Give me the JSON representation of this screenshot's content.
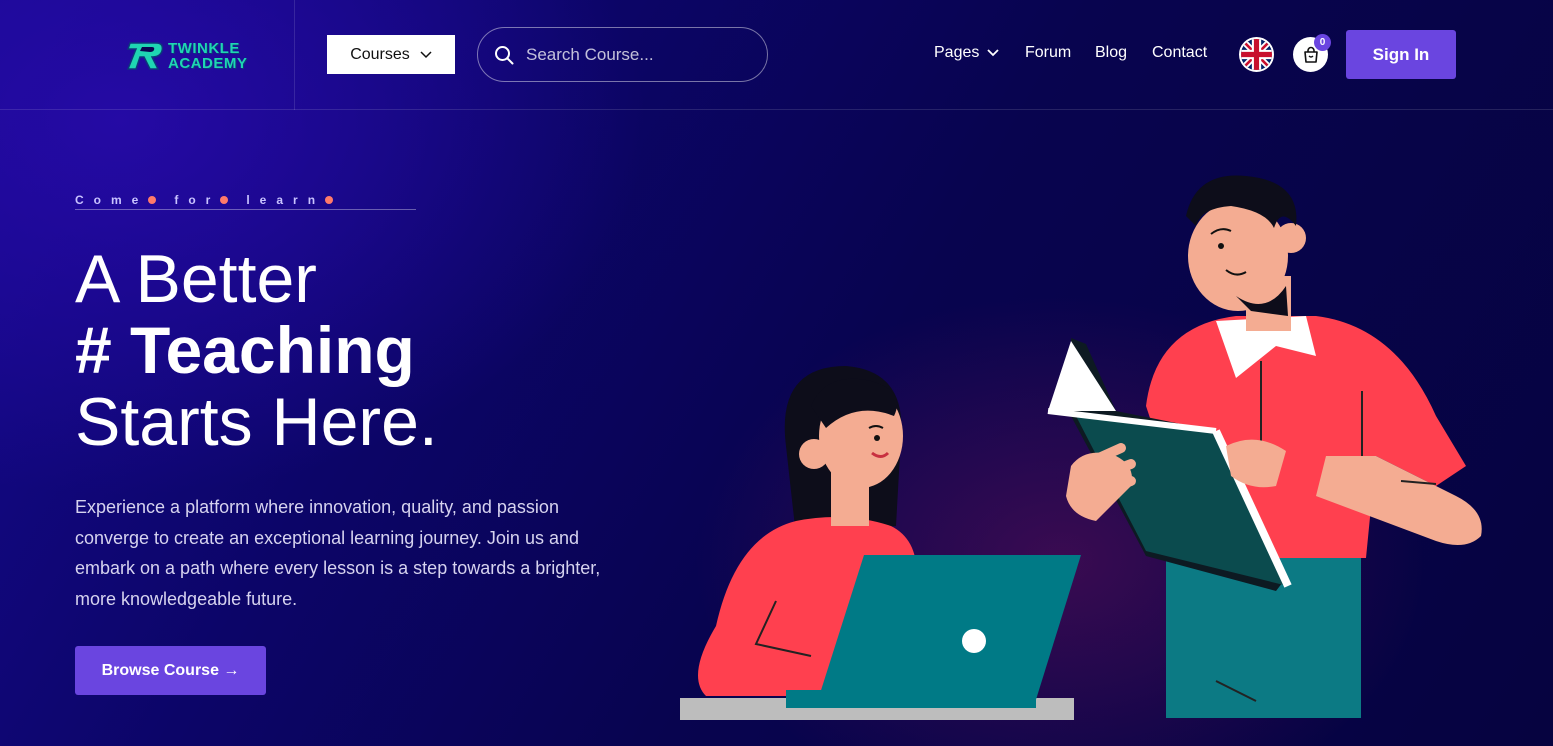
{
  "brand": {
    "name_line1": "TWINKLE",
    "name_line2": "ACADEMY",
    "accent_color": "#6a45e0",
    "logo_color": "#1fd6b2"
  },
  "header": {
    "courses_label": "Courses",
    "search_placeholder": "Search Course...",
    "nav": [
      {
        "label": "Pages",
        "has_dropdown": true
      },
      {
        "label": "Forum",
        "has_dropdown": false
      },
      {
        "label": "Blog",
        "has_dropdown": false
      },
      {
        "label": "Contact",
        "has_dropdown": false
      }
    ],
    "language_icon": "uk-flag-icon",
    "cart_count": "0",
    "signin_label": "Sign In"
  },
  "hero": {
    "tagline": [
      "Come",
      "for",
      "learn"
    ],
    "title_line1": "A Better",
    "title_line2": "# Teaching",
    "title_line3": "Starts Here.",
    "description": "Experience a platform where innovation, quality, and passion converge to create an exceptional learning journey. Join us and embark on a path where every lesson is a step towards a brighter, more knowledgeable future.",
    "cta_label": "Browse Course →"
  }
}
